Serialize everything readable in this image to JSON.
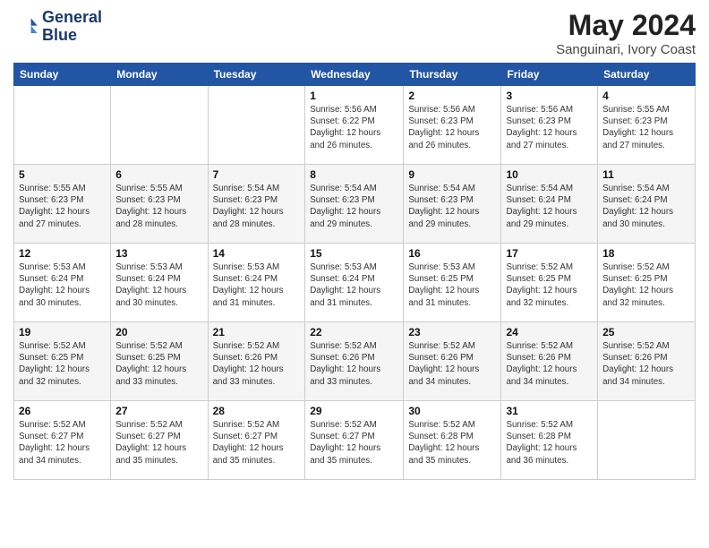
{
  "logo": {
    "line1": "General",
    "line2": "Blue"
  },
  "title": "May 2024",
  "location": "Sanguinari, Ivory Coast",
  "days_header": [
    "Sunday",
    "Monday",
    "Tuesday",
    "Wednesday",
    "Thursday",
    "Friday",
    "Saturday"
  ],
  "weeks": [
    [
      {
        "day": "",
        "info": ""
      },
      {
        "day": "",
        "info": ""
      },
      {
        "day": "",
        "info": ""
      },
      {
        "day": "1",
        "info": "Sunrise: 5:56 AM\nSunset: 6:22 PM\nDaylight: 12 hours\nand 26 minutes."
      },
      {
        "day": "2",
        "info": "Sunrise: 5:56 AM\nSunset: 6:23 PM\nDaylight: 12 hours\nand 26 minutes."
      },
      {
        "day": "3",
        "info": "Sunrise: 5:56 AM\nSunset: 6:23 PM\nDaylight: 12 hours\nand 27 minutes."
      },
      {
        "day": "4",
        "info": "Sunrise: 5:55 AM\nSunset: 6:23 PM\nDaylight: 12 hours\nand 27 minutes."
      }
    ],
    [
      {
        "day": "5",
        "info": "Sunrise: 5:55 AM\nSunset: 6:23 PM\nDaylight: 12 hours\nand 27 minutes."
      },
      {
        "day": "6",
        "info": "Sunrise: 5:55 AM\nSunset: 6:23 PM\nDaylight: 12 hours\nand 28 minutes."
      },
      {
        "day": "7",
        "info": "Sunrise: 5:54 AM\nSunset: 6:23 PM\nDaylight: 12 hours\nand 28 minutes."
      },
      {
        "day": "8",
        "info": "Sunrise: 5:54 AM\nSunset: 6:23 PM\nDaylight: 12 hours\nand 29 minutes."
      },
      {
        "day": "9",
        "info": "Sunrise: 5:54 AM\nSunset: 6:23 PM\nDaylight: 12 hours\nand 29 minutes."
      },
      {
        "day": "10",
        "info": "Sunrise: 5:54 AM\nSunset: 6:24 PM\nDaylight: 12 hours\nand 29 minutes."
      },
      {
        "day": "11",
        "info": "Sunrise: 5:54 AM\nSunset: 6:24 PM\nDaylight: 12 hours\nand 30 minutes."
      }
    ],
    [
      {
        "day": "12",
        "info": "Sunrise: 5:53 AM\nSunset: 6:24 PM\nDaylight: 12 hours\nand 30 minutes."
      },
      {
        "day": "13",
        "info": "Sunrise: 5:53 AM\nSunset: 6:24 PM\nDaylight: 12 hours\nand 30 minutes."
      },
      {
        "day": "14",
        "info": "Sunrise: 5:53 AM\nSunset: 6:24 PM\nDaylight: 12 hours\nand 31 minutes."
      },
      {
        "day": "15",
        "info": "Sunrise: 5:53 AM\nSunset: 6:24 PM\nDaylight: 12 hours\nand 31 minutes."
      },
      {
        "day": "16",
        "info": "Sunrise: 5:53 AM\nSunset: 6:25 PM\nDaylight: 12 hours\nand 31 minutes."
      },
      {
        "day": "17",
        "info": "Sunrise: 5:52 AM\nSunset: 6:25 PM\nDaylight: 12 hours\nand 32 minutes."
      },
      {
        "day": "18",
        "info": "Sunrise: 5:52 AM\nSunset: 6:25 PM\nDaylight: 12 hours\nand 32 minutes."
      }
    ],
    [
      {
        "day": "19",
        "info": "Sunrise: 5:52 AM\nSunset: 6:25 PM\nDaylight: 12 hours\nand 32 minutes."
      },
      {
        "day": "20",
        "info": "Sunrise: 5:52 AM\nSunset: 6:25 PM\nDaylight: 12 hours\nand 33 minutes."
      },
      {
        "day": "21",
        "info": "Sunrise: 5:52 AM\nSunset: 6:26 PM\nDaylight: 12 hours\nand 33 minutes."
      },
      {
        "day": "22",
        "info": "Sunrise: 5:52 AM\nSunset: 6:26 PM\nDaylight: 12 hours\nand 33 minutes."
      },
      {
        "day": "23",
        "info": "Sunrise: 5:52 AM\nSunset: 6:26 PM\nDaylight: 12 hours\nand 34 minutes."
      },
      {
        "day": "24",
        "info": "Sunrise: 5:52 AM\nSunset: 6:26 PM\nDaylight: 12 hours\nand 34 minutes."
      },
      {
        "day": "25",
        "info": "Sunrise: 5:52 AM\nSunset: 6:26 PM\nDaylight: 12 hours\nand 34 minutes."
      }
    ],
    [
      {
        "day": "26",
        "info": "Sunrise: 5:52 AM\nSunset: 6:27 PM\nDaylight: 12 hours\nand 34 minutes."
      },
      {
        "day": "27",
        "info": "Sunrise: 5:52 AM\nSunset: 6:27 PM\nDaylight: 12 hours\nand 35 minutes."
      },
      {
        "day": "28",
        "info": "Sunrise: 5:52 AM\nSunset: 6:27 PM\nDaylight: 12 hours\nand 35 minutes."
      },
      {
        "day": "29",
        "info": "Sunrise: 5:52 AM\nSunset: 6:27 PM\nDaylight: 12 hours\nand 35 minutes."
      },
      {
        "day": "30",
        "info": "Sunrise: 5:52 AM\nSunset: 6:28 PM\nDaylight: 12 hours\nand 35 minutes."
      },
      {
        "day": "31",
        "info": "Sunrise: 5:52 AM\nSunset: 6:28 PM\nDaylight: 12 hours\nand 36 minutes."
      },
      {
        "day": "",
        "info": ""
      }
    ]
  ]
}
